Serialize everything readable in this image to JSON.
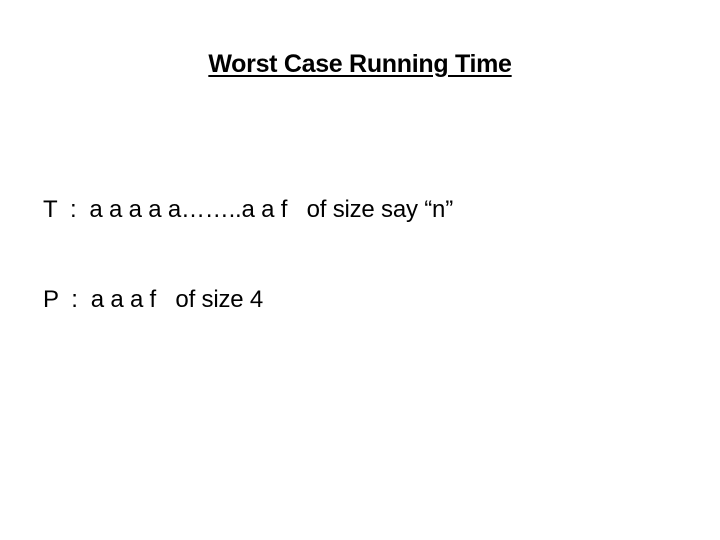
{
  "slide": {
    "title": "Worst Case Running Time",
    "lines": [
      {
        "label": "T",
        "text": "T  :  a a a a a……..a a f   of size say “n”"
      },
      {
        "label": "P",
        "text": "P  :  a a a f   of size 4"
      }
    ]
  }
}
